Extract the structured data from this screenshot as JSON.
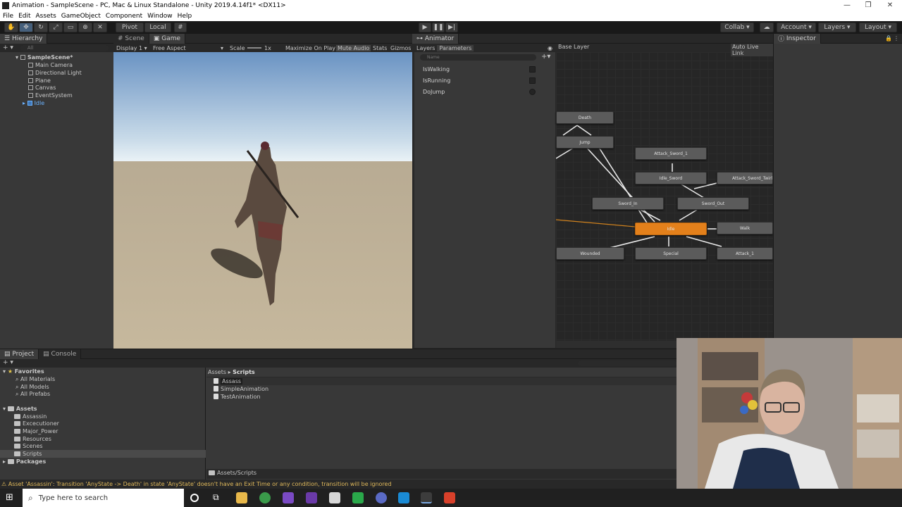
{
  "window": {
    "title": "Animation - SampleScene - PC, Mac & Linux Standalone - Unity 2019.4.14f1* <DX11>",
    "minimize": "—",
    "maximize": "❐",
    "close": "✕"
  },
  "menu": [
    "File",
    "Edit",
    "Assets",
    "GameObject",
    "Component",
    "Window",
    "Help"
  ],
  "toolbar": {
    "pivot": "Pivot",
    "local": "Local",
    "collab": "Collab ▾",
    "account": "Account ▾",
    "layers": "Layers ▾",
    "layout": "Layout ▾"
  },
  "hierarchy": {
    "tab": "Hierarchy",
    "search_placeholder": "All",
    "scene": "SampleScene*",
    "items": [
      "Main Camera",
      "Directional Light",
      "Plane",
      "Canvas",
      "EventSystem",
      "Idle"
    ]
  },
  "scene_view": {
    "tabs": [
      "Scene",
      "Game"
    ],
    "display": "Display 1",
    "aspect": "Free Aspect",
    "scale_label": "Scale",
    "scale_value": "1x",
    "maximize": "Maximize On Play",
    "mute": "Mute Audio",
    "stats": "Stats",
    "gizmos": "Gizmos"
  },
  "animator": {
    "tab": "Animator",
    "subtabs": [
      "Layers",
      "Parameters"
    ],
    "search_placeholder": "Name",
    "base_layer": "Base Layer",
    "auto_live_link": "Auto Live Link",
    "parameters": [
      {
        "name": "IsWalking",
        "type": "bool"
      },
      {
        "name": "IsRunning",
        "type": "bool"
      },
      {
        "name": "DoJump",
        "type": "trigger"
      }
    ],
    "states": [
      "Death",
      "Jump",
      "Attack_Sword_1",
      "Idle_Sword",
      "Attack_Sword_Twirl",
      "Sword_In",
      "Sword_Out",
      "Idle",
      "Walk",
      "Wounded",
      "Special",
      "Attack_1"
    ],
    "default_state": "Idle",
    "default_color": "#e3801b"
  },
  "inspector": {
    "tab": "Inspector"
  },
  "project": {
    "tabs": [
      "Project",
      "Console"
    ],
    "favorites_label": "Favorites",
    "favorites": [
      "All Materials",
      "All Models",
      "All Prefabs"
    ],
    "assets_label": "Assets",
    "asset_folders": [
      "Assassin",
      "Excecutioner",
      "Major_Power",
      "Resources",
      "Scenes",
      "Scripts"
    ],
    "packages_label": "Packages",
    "breadcrumb": [
      "Assets",
      "Scripts"
    ],
    "files": [
      "Assass",
      "SimpleAnimation",
      "TestAnimation"
    ],
    "path": "Assets/Scripts"
  },
  "status": {
    "message": "Asset 'Assassin': Transition 'AnyState -> Death' in state 'AnyState' doesn't have an Exit Time or any condition, transition will be ignored",
    "color": "#e0b95b"
  },
  "taskbar": {
    "search_placeholder": "Type here to search"
  }
}
